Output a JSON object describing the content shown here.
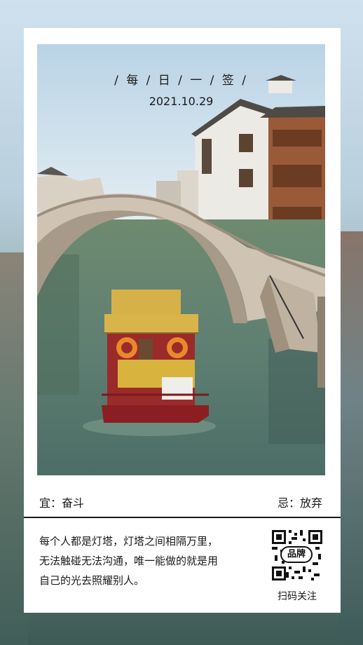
{
  "sign": {
    "title": "/ 每 / 日 / 一 / 签 /",
    "date": "2021.10.29"
  },
  "advice": {
    "yi": "宜：奋斗",
    "ji": "忌：放弃"
  },
  "quote": {
    "lines": [
      "每个人都是灯塔，灯塔之间相隔万里，",
      "无法触碰无法沟通，唯一能做的就是用",
      "自己的光去照耀别人。"
    ]
  },
  "qr": {
    "badge": "品牌",
    "caption": "扫码关注"
  },
  "colors": {
    "text": "#1a1a1a",
    "card": "#ffffff"
  }
}
